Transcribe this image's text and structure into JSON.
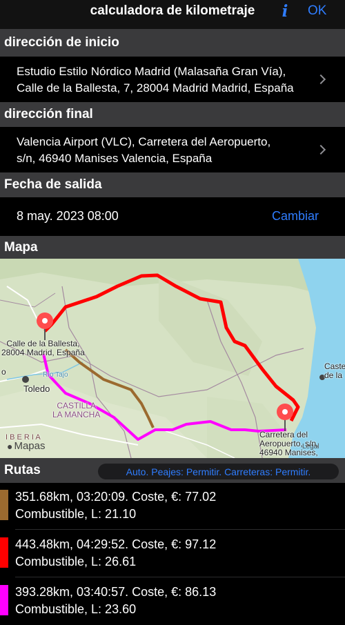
{
  "nav": {
    "title": "calculadora de kilometraje",
    "info_label": "i",
    "ok_label": "OK"
  },
  "start": {
    "header": "dirección de inicio",
    "line1": "Estudio Estilo Nórdico Madrid (Malasaña Gran Vía),",
    "line2": "Calle de la Ballesta, 7, 28004 Madrid Madrid, España"
  },
  "end": {
    "header": "dirección final",
    "line1": "Valencia Airport (VLC), Carretera del Aeropuerto,",
    "line2": "s/n, 46940 Manises Valencia, España"
  },
  "departure": {
    "header": "Fecha de salida",
    "value": "8 may. 2023 08:00",
    "change_label": "Cambiar"
  },
  "map": {
    "header": "Mapa",
    "labels": {
      "start_pin_l1": "Calle de la Ballesta,",
      "start_pin_l2": "28004 Madrid, España",
      "end_pin_l1": "Carretera del",
      "end_pin_l2": "Aeropuerto, s/n,",
      "end_pin_l3": "46940 Manises,",
      "toledo": "Toledo",
      "castilla_l1": "CASTILLA",
      "castilla_l2": "LA MANCHA",
      "iberia": "I B E R I A",
      "rio_tajo": "Río Tajo",
      "castellon_l1": "Caste",
      "castellon_l2": "de la",
      "left_o": "o",
      "brand": "Mapas",
      "legal": "Legal"
    }
  },
  "routes": {
    "header": "Rutas",
    "options": "Auto. Peajes: Permitir. Carreteras: Permitir.",
    "items": [
      {
        "color": "#9b6a2f",
        "line1": "351.68km, 03:20:09. Coste, €: 77.02",
        "line2": "Combustible, L: 21.10"
      },
      {
        "color": "#ff0000",
        "line1": "443.48km, 04:29:52. Coste, €: 97.12",
        "line2": "Combustible, L: 26.61"
      },
      {
        "color": "#ff00ff",
        "line1": "393.28km, 03:40:57. Coste, €: 86.13",
        "line2": "Combustible, L: 23.60"
      }
    ]
  },
  "colors": {
    "accent": "#2f7dff",
    "route_brown": "#9b6a2f",
    "route_red": "#ff0000",
    "route_magenta": "#ff00ff"
  }
}
